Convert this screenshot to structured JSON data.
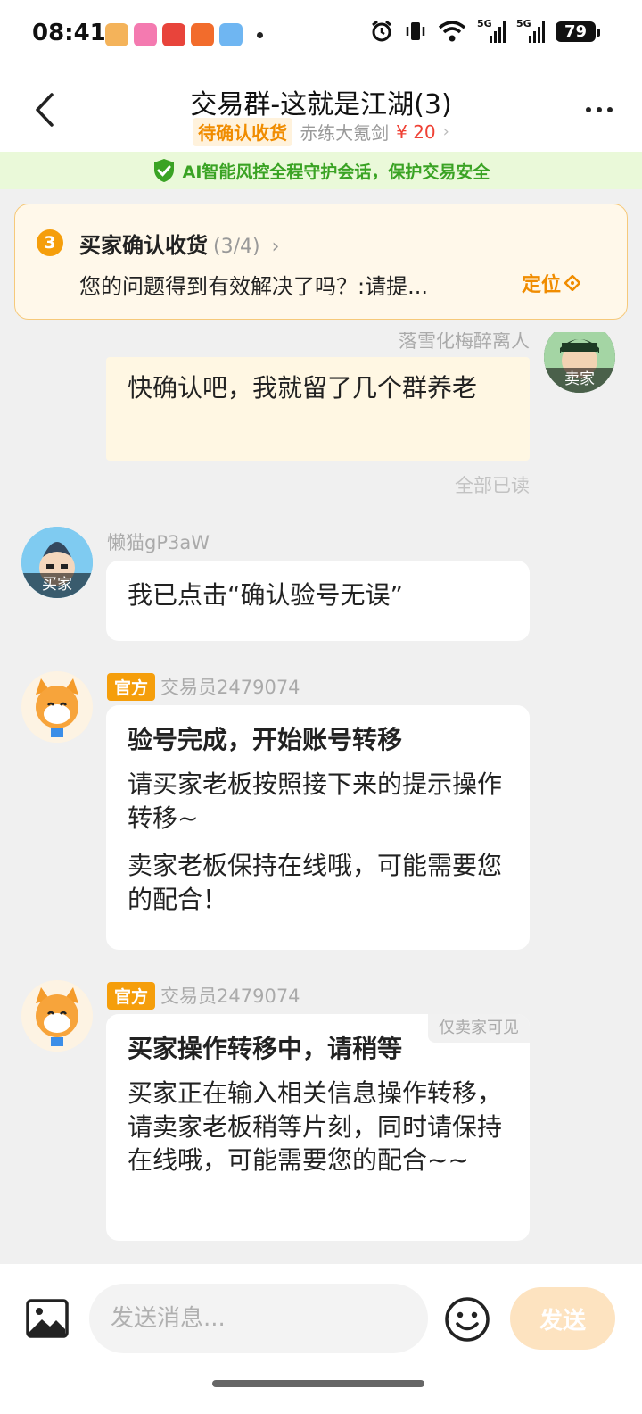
{
  "status_bar": {
    "time": "08:41",
    "network_1": "5G",
    "network_2": "5G",
    "battery": "79"
  },
  "header": {
    "title": "交易群-这就是江湖(3)",
    "order_status": "待确认收货",
    "item_name": "赤练大氪剑",
    "price": "¥ 20"
  },
  "ai_banner": {
    "text": "AI智能风控全程守护会话，保护交易安全"
  },
  "step_card": {
    "step_number": "3",
    "title": "买家确认收货",
    "progress": "(3/4)",
    "description": "您的问题得到有效解决了吗？:请提...",
    "locate_label": "定位"
  },
  "messages": [
    {
      "sender": "落雪化梅醉离人",
      "role_tag": "卖家",
      "text": "快确认吧，我就留了几个群养老",
      "read_status": "全部已读"
    },
    {
      "sender": "懒猫gP3aW",
      "role_tag": "买家",
      "text": "我已点击“确认验号无误”"
    },
    {
      "badge": "官方",
      "sender": "交易员2479074",
      "title": "验号完成，开始账号转移",
      "para1": "请买家老板按照接下来的提示操作转移~",
      "para2": "卖家老板保持在线哦，可能需要您的配合！"
    },
    {
      "badge": "官方",
      "sender": "交易员2479074",
      "visibility": "仅卖家可见",
      "title": "买家操作转移中，请稍等",
      "para1": "买家正在输入相关信息操作转移，请卖家老板稍等片刻，同时请保持在线哦，可能需要您的配合~~"
    }
  ],
  "input_bar": {
    "placeholder": "发送消息...",
    "send_label": "发送"
  },
  "colors": {
    "accent_orange": "#f59e0b",
    "price_red": "#ef4135",
    "ai_green": "#3aa324"
  }
}
